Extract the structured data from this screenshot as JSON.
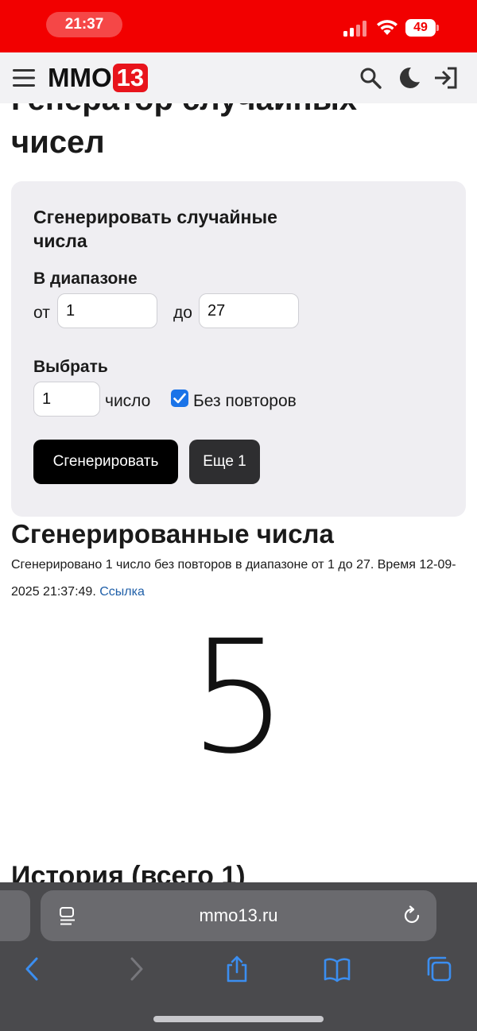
{
  "status_bar": {
    "time": "21:37",
    "battery": "49"
  },
  "header": {
    "logo_text": "MMO",
    "logo_badge": "13"
  },
  "page": {
    "title": "Генератор случайных чисел"
  },
  "generator": {
    "title": "Сгенерировать случайные числа",
    "range_label": "В диапазоне",
    "from_label": "от",
    "from_value": "1",
    "to_label": "до",
    "to_value": "27",
    "pick_label": "Выбрать",
    "count_value": "1",
    "count_unit": "число",
    "no_repeat_label": "Без повторов",
    "no_repeat_checked": true,
    "generate_button": "Сгенерировать",
    "more_button": "Еще 1"
  },
  "results": {
    "title": "Сгенерированные числа",
    "description": "Сгенерировано 1 число без повторов в диапазоне от 1 до 27. Время 12-09-2025 21:37:49.",
    "link": "Ссылка",
    "number": "5"
  },
  "history": {
    "title": "История (всего 1)"
  },
  "browser": {
    "url": "mmo13.ru"
  },
  "colors": {
    "status_bar": "#f20000",
    "logo_badge": "#e8141c",
    "link": "#1f5fa8",
    "checkbox": "#1a73e8",
    "nav_icons": "#3b8ef0"
  }
}
